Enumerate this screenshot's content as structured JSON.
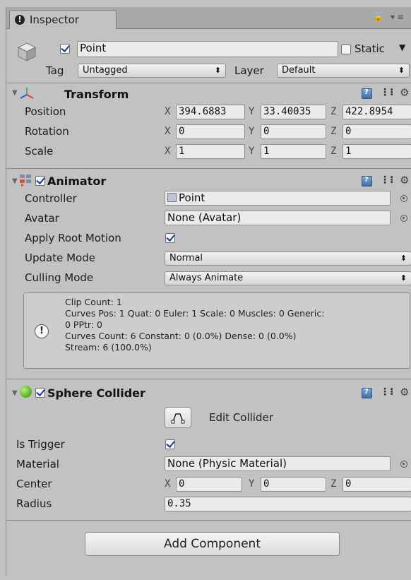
{
  "tab": {
    "label": "Inspector",
    "info_glyph": "!",
    "tools": "🔒 ▾≡"
  },
  "object": {
    "name": "Point",
    "active": true,
    "static_label": "Static",
    "static": false
  },
  "tag": {
    "label": "Tag",
    "value": "Untagged"
  },
  "layer": {
    "label": "Layer",
    "value": "Default"
  },
  "transform": {
    "title": "Transform",
    "rows": [
      {
        "label": "Position",
        "x": "394.6883",
        "y": "33.40035",
        "z": "422.8954"
      },
      {
        "label": "Rotation",
        "x": "0",
        "y": "0",
        "z": "0"
      },
      {
        "label": "Scale",
        "x": "1",
        "y": "1",
        "z": "1"
      }
    ],
    "axis": {
      "x": "X",
      "y": "Y",
      "z": "Z"
    }
  },
  "animator": {
    "title": "Animator",
    "enabled": true,
    "controller_label": "Controller",
    "controller_value": "Point",
    "avatar_label": "Avatar",
    "avatar_value": "None (Avatar)",
    "apply_root_motion_label": "Apply Root Motion",
    "apply_root_motion": true,
    "update_mode_label": "Update Mode",
    "update_mode": "Normal",
    "culling_mode_label": "Culling Mode",
    "culling_mode": "Always Animate",
    "info": {
      "line1": "Clip Count: 1",
      "line2": "Curves Pos: 1 Quat: 0 Euler: 1 Scale: 0 Muscles: 0 Generic:",
      "line3": "0 PPtr: 0",
      "line4": "Curves Count: 6 Constant: 0 (0.0%) Dense: 0 (0.0%)",
      "line5": "Stream: 6 (100.0%)"
    }
  },
  "sphere_collider": {
    "title": "Sphere Collider",
    "enabled": true,
    "edit_label": "Edit Collider",
    "is_trigger_label": "Is Trigger",
    "is_trigger": true,
    "material_label": "Material",
    "material_value": "None (Physic Material)",
    "center_label": "Center",
    "center": {
      "x": "0",
      "y": "0",
      "z": "0"
    },
    "radius_label": "Radius",
    "radius": "0.35"
  },
  "add_component_label": "Add Component",
  "colors": {
    "background": "#c2c2c2",
    "check": "#1b3d8a",
    "collider_icon": "#5fb72d"
  }
}
